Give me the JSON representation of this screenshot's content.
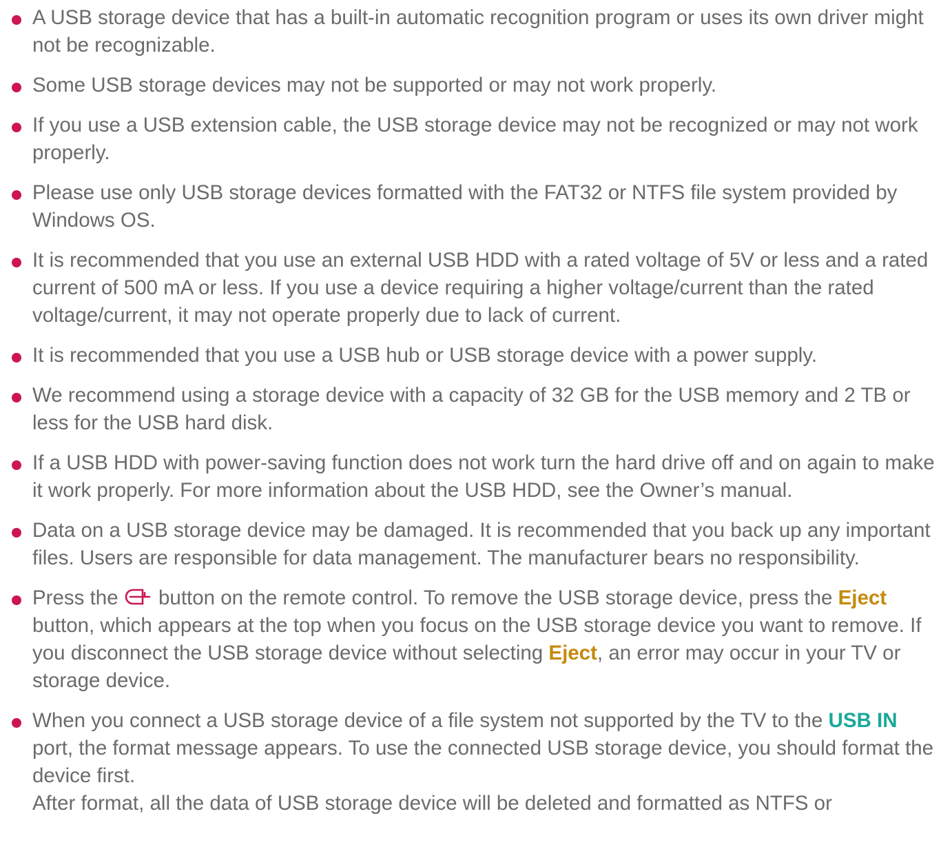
{
  "notes": [
    {
      "text": "A USB storage device that has a built-in automatic recognition program or uses its own driver might not be recognizable."
    },
    {
      "text": "Some USB storage devices may not be supported or may not work properly."
    },
    {
      "text": "If you use a USB extension cable, the USB storage device may not be recognized or may not work properly."
    },
    {
      "text": "Please use only USB storage devices formatted with the FAT32 or NTFS file system provided by Windows OS."
    },
    {
      "text": "It is recommended that you use an external USB HDD with a rated voltage of 5V or less and a rated current of 500 mA or less. If you use a device requiring a higher voltage/current than the rated voltage/current, it may not operate properly due to lack of current."
    },
    {
      "text": "It is recommended that you use a USB hub or USB storage device with a power supply."
    },
    {
      "text": "We recommend using a storage device with a capacity of 32 GB for the USB memory and 2 TB or less for the USB hard disk."
    },
    {
      "text": "If a USB HDD with power-saving function does not work turn the hard drive off and on again to make it work properly. For more information about the USB HDD, see the Owner’s manual."
    },
    {
      "text": "Data on a USB storage device may be damaged. It is recommended that you back up any important files. Users are responsible for data management. The manufacturer bears no responsibility."
    }
  ],
  "eject_note": {
    "part1": "Press the ",
    "icon": "home-icon",
    "part2": " button on the remote control. To remove the USB storage device, press the ",
    "keyword1": "Eject",
    "part3": " button, which appears at the top when you focus on the USB storage device you want to remove. If you disconnect the USB storage device without selecting ",
    "keyword2": "Eject",
    "part4": ", an error may occur in your TV or storage device."
  },
  "format_note": {
    "part1": "When you connect a USB storage device of a file system not supported by the TV to the ",
    "keyword": "USB IN",
    "part2": " port, the format message appears. To use the connected USB storage device, you should format the device first.",
    "continuation": "After format, all the data of USB storage device will be deleted and formatted as NTFS or"
  },
  "colors": {
    "bullet": "#cc1557",
    "text": "#6b6b6b",
    "keyword_orange": "#c48a0e",
    "keyword_teal": "#1aa89a",
    "icon": "#cc1557"
  }
}
